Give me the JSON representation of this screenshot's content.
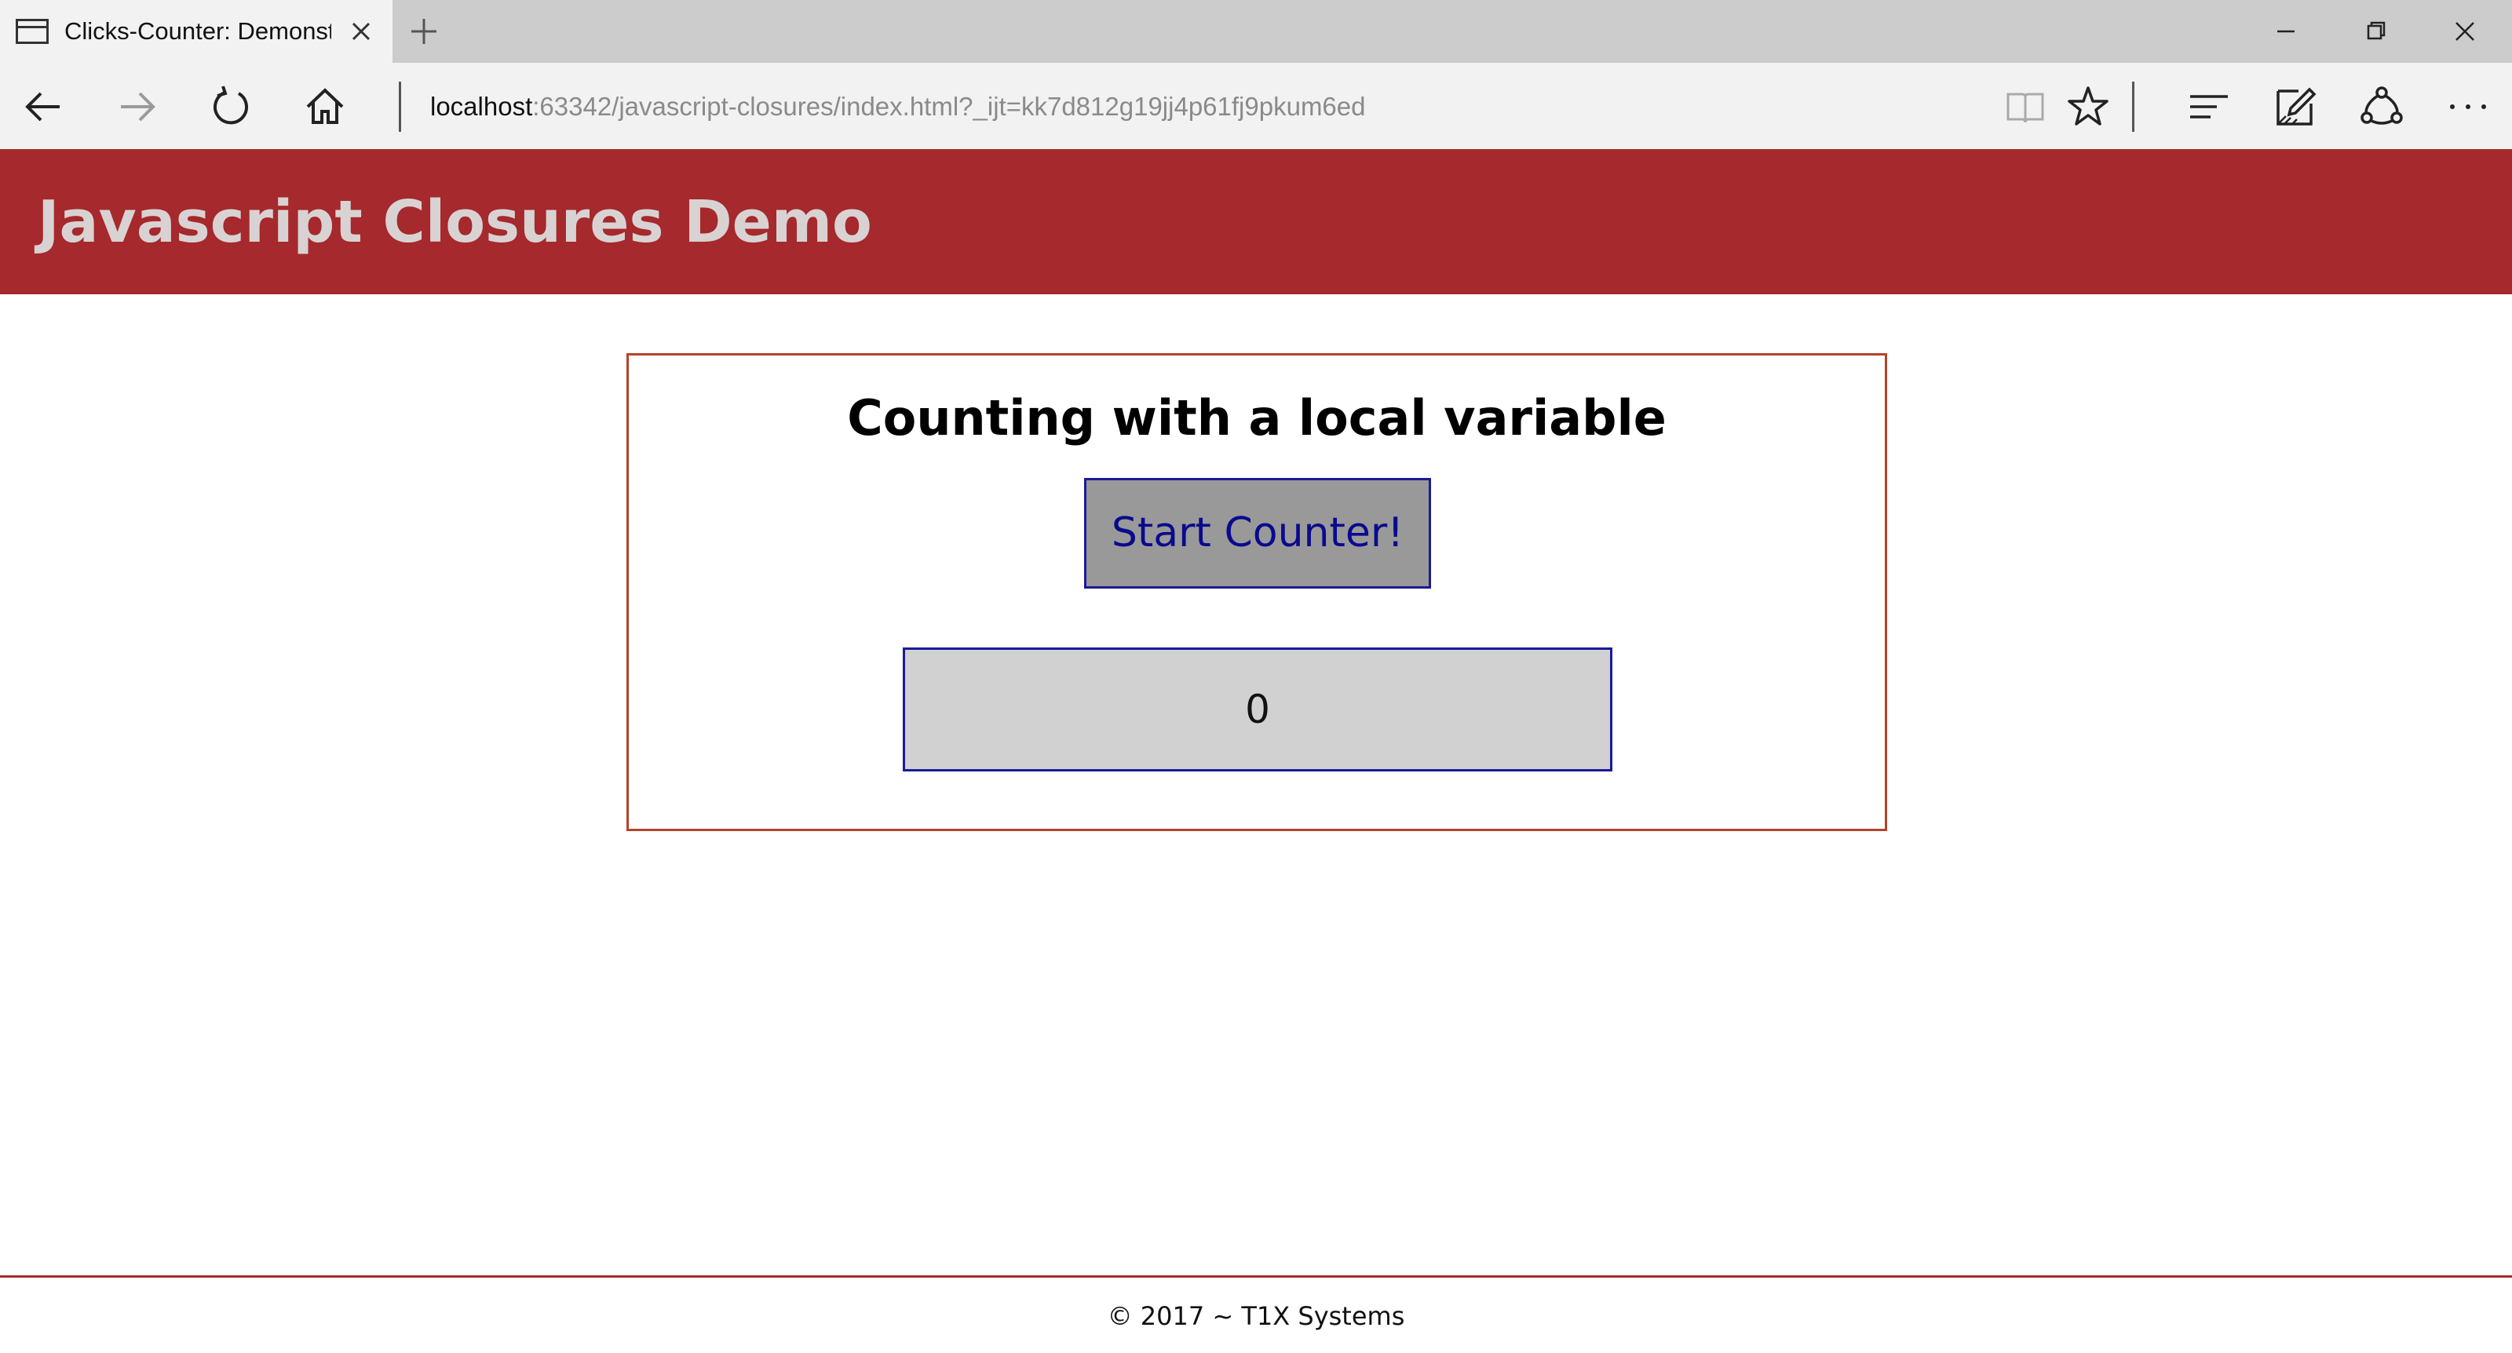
{
  "browser": {
    "tab_title": "Clicks-Counter: Demonstrating Closures",
    "address": {
      "host": "localhost",
      "rest": ":63342/javascript-closures/index.html?_ijt=kk7d812g19jj4p61fj9pkum6ed"
    }
  },
  "page": {
    "site_title": "Javascript Closures Demo",
    "section_heading": "Counting with a local variable",
    "start_button_label": "Start Counter!",
    "counter_value": "0",
    "footer_text": "© 2017 ~ T1X Systems"
  },
  "colors": {
    "header_bg": "#a5292d",
    "box_border": "#b5432a",
    "button_border": "#1a1a9a"
  }
}
